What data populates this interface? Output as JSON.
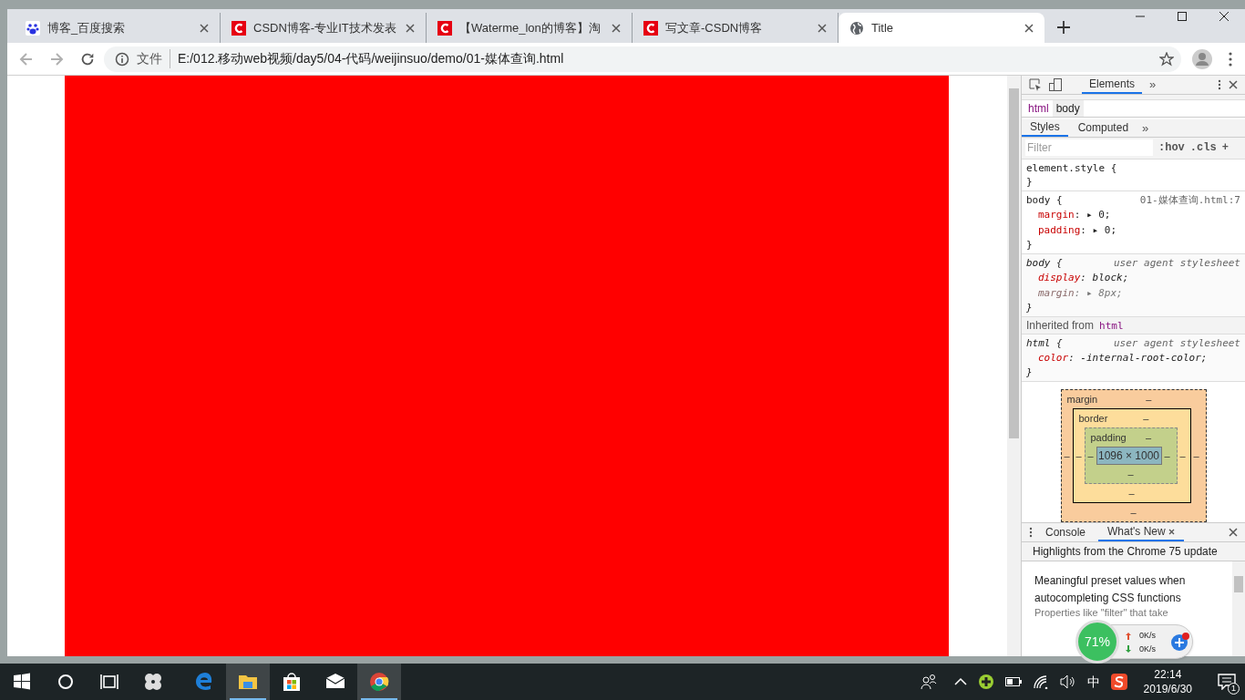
{
  "tabs": [
    {
      "title": "博客_百度搜索",
      "kind": "paw",
      "selected": false
    },
    {
      "title": "CSDN博客-专业IT技术发表",
      "kind": "brand",
      "selected": false
    },
    {
      "title": "【Waterme_lon的博客】淘",
      "kind": "brand",
      "selected": false
    },
    {
      "title": "写文章-CSDN博客",
      "kind": "brand",
      "selected": false
    },
    {
      "title": "Title",
      "kind": "web",
      "selected": true
    }
  ],
  "address_bar": {
    "scheme_label": "文件",
    "url": "E:/012.移动web视频/day5/04-代码/weijinsuo/demo/01-媒体查询.html"
  },
  "devtools": {
    "tabs": [
      {
        "label": "Elements",
        "selected": true
      }
    ],
    "more": "»",
    "breadcrumbs": [
      {
        "label": "html",
        "selected": false
      },
      {
        "label": "body",
        "selected": true
      }
    ],
    "sub_tabs": [
      {
        "label": "Styles",
        "selected": true
      },
      {
        "label": "Computed",
        "selected": false
      }
    ],
    "sub_more": "»",
    "filter": {
      "placeholder": "Filter"
    },
    "filter_buttons": [
      ":hov",
      ".cls",
      "+"
    ],
    "rules": [
      {
        "kind": "rule",
        "selector": "element.style {",
        "close": "}",
        "user_agent": false
      },
      {
        "kind": "rule",
        "selector": "body {",
        "source": "01-媒体查询.html:7",
        "close": "}",
        "user_agent": false,
        "properties": [
          {
            "name": "margin",
            "value": ": ▸ 0;",
            "overridden": false
          },
          {
            "name": "padding",
            "value": ": ▸ 0;",
            "overridden": false
          }
        ]
      },
      {
        "kind": "rule",
        "selector": "body {",
        "source": "user agent stylesheet",
        "close": "}",
        "user_agent": true,
        "properties": [
          {
            "name": "display",
            "value": ": block;",
            "overridden": false
          },
          {
            "name": "margin",
            "value": ": ▸ 8px;",
            "overridden": true
          }
        ]
      },
      {
        "kind": "inherited",
        "label": "Inherited from",
        "from": "html"
      },
      {
        "kind": "rule",
        "selector": "html {",
        "source": "user agent stylesheet",
        "close": "}",
        "user_agent": true,
        "properties": [
          {
            "name": "color",
            "value": ": -internal-root-color;",
            "overridden": false
          }
        ]
      }
    ],
    "box_model": {
      "margin": {
        "label": "margin",
        "top": "–",
        "right": "–",
        "bottom": "–",
        "left": "–"
      },
      "border": {
        "label": "border",
        "top": "–",
        "right": "–",
        "bottom": "–",
        "left": "–"
      },
      "padding": {
        "label": "padding",
        "top": "–",
        "right": "–",
        "bottom": "–",
        "left": "–"
      },
      "content": "1096 × 1000"
    },
    "drawer_tabs": [
      {
        "label": "Console",
        "selected": false,
        "closable": false
      },
      {
        "label": "What's New",
        "selected": true,
        "closable": true
      }
    ],
    "whats_new": {
      "heading": "Highlights from the Chrome 75 update",
      "items": [
        {
          "title": "Meaningful preset values when autocompleting CSS functions",
          "description": "Properties like \"filter\" that take"
        }
      ]
    }
  },
  "net_widget": {
    "percent": "71%",
    "upload": "0K/s",
    "download": "0K/s"
  },
  "taskbar": {
    "apps": [
      {
        "kind": "browser",
        "active": false
      },
      {
        "kind": "files",
        "active": true
      },
      {
        "kind": "shop",
        "active": false
      },
      {
        "kind": "mail",
        "active": false
      },
      {
        "kind": "web",
        "active": true
      }
    ],
    "ime": "中",
    "time": "22:14",
    "date": "2019/6/30",
    "notifications": "1"
  }
}
